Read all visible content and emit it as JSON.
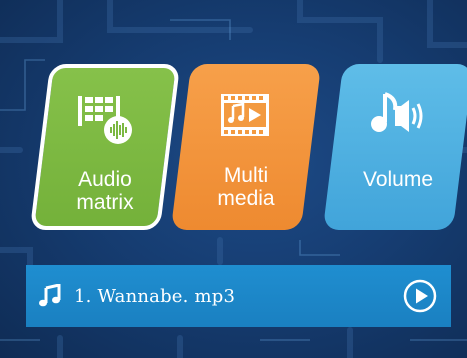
{
  "menu": {
    "tiles": [
      {
        "label": "Audio\nmatrix",
        "icon": "audio-matrix-icon",
        "color": "#7cb842",
        "selected": true
      },
      {
        "label": "Multi\nmedia",
        "icon": "multimedia-icon",
        "color": "#f39a40",
        "selected": false
      },
      {
        "label": "Volume",
        "icon": "volume-icon",
        "color": "#4fb0e0",
        "selected": false
      }
    ]
  },
  "player": {
    "track": "1. Wannabe. mp3",
    "note_icon": "music-note-icon",
    "play_icon": "play-icon",
    "bar_color": "#1c86c8"
  },
  "colors": {
    "background": "#163d72",
    "selected_border": "#ffffff"
  }
}
